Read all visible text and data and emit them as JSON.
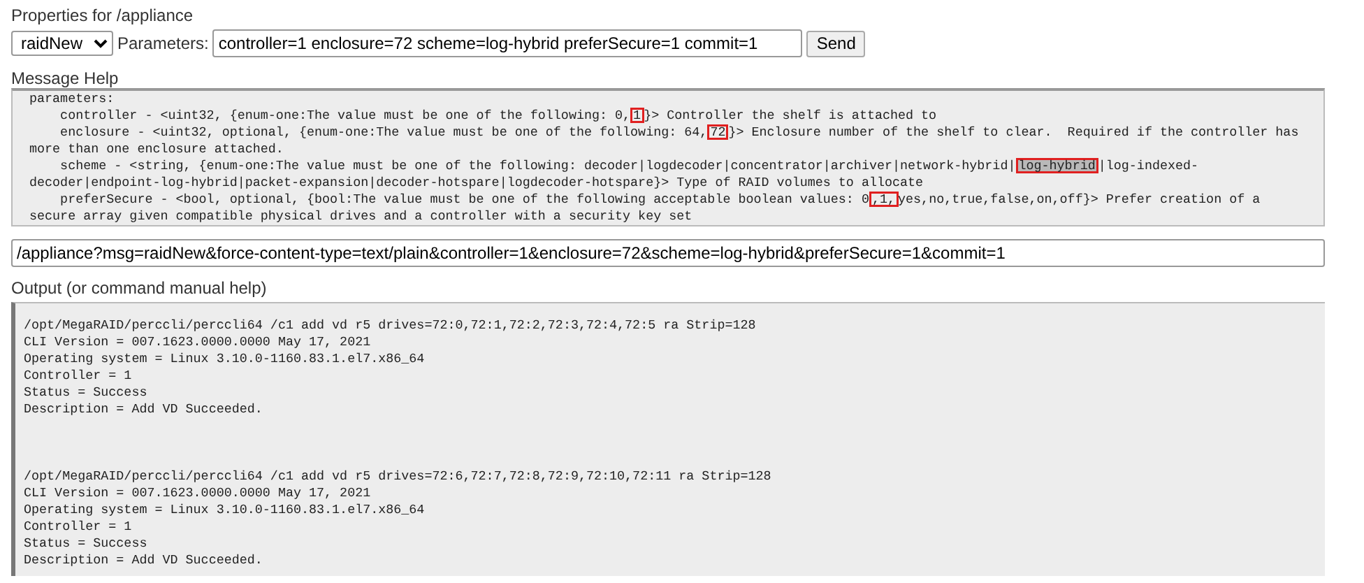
{
  "properties": {
    "title": "Properties for /appliance",
    "message_select": {
      "value": "raidNew"
    },
    "parameters_label": "Parameters:",
    "parameters_field": {
      "value": "controller=1 enclosure=72 scheme=log-hybrid preferSecure=1 commit=1"
    },
    "send_button": "Send"
  },
  "message_help": {
    "label": "Message Help",
    "lines": [
      [
        {
          "text": "parameters:"
        }
      ],
      [
        {
          "text": "    controller - <uint32, {enum-one:The value must be one of the following: 0,"
        },
        {
          "text": "1",
          "boxed": true,
          "shaded": false
        },
        {
          "text": "}> Controller the shelf is attached to"
        }
      ],
      [
        {
          "text": "    enclosure - <uint32, optional, {enum-one:The value must be one of the following: 64,"
        },
        {
          "text": "72",
          "boxed": true,
          "shaded": false
        },
        {
          "text": "}> Enclosure number of the shelf to clear.  Required if the controller has"
        }
      ],
      [
        {
          "text": "more than one enclosure attached."
        }
      ],
      [
        {
          "text": "    scheme - <string, {enum-one:The value must be one of the following: decoder|logdecoder|concentrator|archiver|network-hybrid|"
        },
        {
          "text": "log-hybrid",
          "boxed": true,
          "shaded": true
        },
        {
          "text": "|log-indexed-"
        }
      ],
      [
        {
          "text": "decoder|endpoint-log-hybrid|packet-expansion|decoder-hotspare|logdecoder-hotspare}> Type of RAID volumes to allocate"
        }
      ],
      [
        {
          "text": "    preferSecure - <bool, optional, {bool:The value must be one of the following acceptable boolean values: 0"
        },
        {
          "text": ",1,",
          "boxed": true,
          "shaded": false
        },
        {
          "text": "yes,no,true,false,on,off}> Prefer creation of a"
        }
      ],
      [
        {
          "text": "secure array given compatible physical drives and a controller with a security key set"
        }
      ]
    ]
  },
  "url_field": {
    "value": "/appliance?msg=raidNew&force-content-type=text/plain&controller=1&enclosure=72&scheme=log-hybrid&preferSecure=1&commit=1"
  },
  "output": {
    "label": "Output (or command manual help)",
    "blocks": [
      [
        "/opt/MegaRAID/perccli/perccli64 /c1 add vd r5 drives=72:0,72:1,72:2,72:3,72:4,72:5 ra Strip=128",
        "CLI Version = 007.1623.0000.0000 May 17, 2021",
        "Operating system = Linux 3.10.0-1160.83.1.el7.x86_64",
        "Controller = 1",
        "Status = Success",
        "Description = Add VD Succeeded."
      ],
      [
        "/opt/MegaRAID/perccli/perccli64 /c1 add vd r5 drives=72:6,72:7,72:8,72:9,72:10,72:11 ra Strip=128",
        "CLI Version = 007.1623.0000.0000 May 17, 2021",
        "Operating system = Linux 3.10.0-1160.83.1.el7.x86_64",
        "Controller = 1",
        "Status = Success",
        "Description = Add VD Succeeded."
      ]
    ]
  }
}
